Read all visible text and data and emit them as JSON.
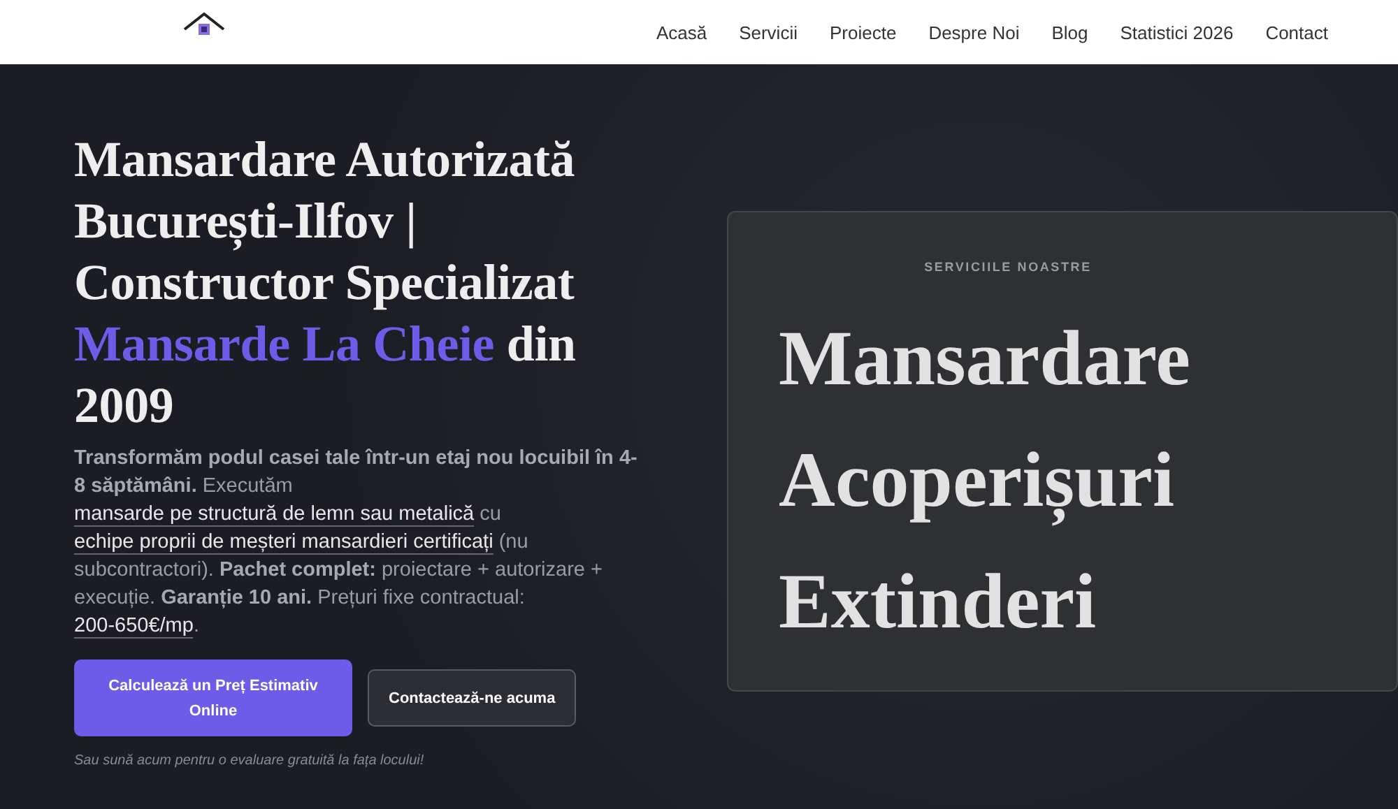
{
  "nav": {
    "items": [
      {
        "label": "Acasă"
      },
      {
        "label": "Servicii"
      },
      {
        "label": "Proiecte"
      },
      {
        "label": "Despre Noi"
      },
      {
        "label": "Blog"
      },
      {
        "label": "Statistici 2026"
      },
      {
        "label": "Contact"
      }
    ]
  },
  "hero": {
    "title": [
      {
        "text": "Mansardare Autorizată București-Ilfov | Constructor Specializat ",
        "kind": "plain"
      },
      {
        "text": "Mansarde La Cheie",
        "kind": "accent"
      },
      {
        "text": " din 2009",
        "kind": "plain"
      }
    ],
    "intro": [
      {
        "text": "Transformăm podul casei tale într-un etaj nou locuibil în 4-8 săptămâni.",
        "kind": "bold"
      },
      {
        "text": " Executăm ",
        "kind": "plain"
      },
      {
        "text": "mansarde pe structură de lemn sau metalică",
        "kind": "link"
      },
      {
        "text": " cu ",
        "kind": "plain"
      },
      {
        "text": "echipe proprii de meșteri mansardieri certificați",
        "kind": "link"
      },
      {
        "text": " (nu subcontractori). ",
        "kind": "plain"
      },
      {
        "text": "Pachet complet:",
        "kind": "bold"
      },
      {
        "text": " proiectare + autorizare + execuție. ",
        "kind": "plain"
      },
      {
        "text": "Garanție 10 ani.",
        "kind": "bold"
      },
      {
        "text": " Prețuri fixe contractual: ",
        "kind": "plain"
      },
      {
        "text": "200-650€/mp",
        "kind": "link"
      },
      {
        "text": ".",
        "kind": "plain"
      }
    ],
    "buttons": [
      {
        "label": "Calculează un Preț Estimativ Online",
        "kind": "primary"
      },
      {
        "label": "Contactează-ne acuma",
        "kind": "secondary"
      }
    ],
    "note": "Sau sună acum pentru o evaluare gratuită la fața locului!"
  },
  "services_card": {
    "eyebrow": "SERVICIILE NOASTRE",
    "items": [
      "Mansardare",
      "Acoperișuri",
      "Extinderi"
    ]
  }
}
